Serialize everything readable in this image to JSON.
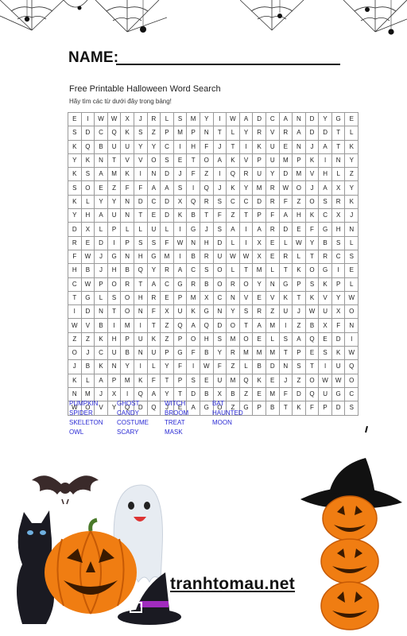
{
  "header": {
    "name_label": "NAME:"
  },
  "puzzle": {
    "title": "Free Printable Halloween Word Search",
    "subtitle": "Hãy tìm các từ dưới đây trong bảng!",
    "grid": [
      [
        "E",
        "I",
        "W",
        "W",
        "X",
        "J",
        "R",
        "L",
        "S",
        "M",
        "Y",
        "I",
        "W",
        "A",
        "D",
        "C",
        "A",
        "N",
        "D",
        "Y",
        "G",
        "E"
      ],
      [
        "S",
        "D",
        "C",
        "Q",
        "K",
        "S",
        "Z",
        "P",
        "M",
        "P",
        "N",
        "T",
        "L",
        "Y",
        "R",
        "V",
        "R",
        "A",
        "D",
        "D",
        "T",
        "L"
      ],
      [
        "K",
        "Q",
        "B",
        "U",
        "U",
        "Y",
        "Y",
        "C",
        "I",
        "H",
        "F",
        "J",
        "T",
        "I",
        "K",
        "U",
        "E",
        "N",
        "J",
        "A",
        "T",
        "K"
      ],
      [
        "Y",
        "K",
        "N",
        "T",
        "V",
        "V",
        "O",
        "S",
        "E",
        "T",
        "O",
        "A",
        "K",
        "V",
        "P",
        "U",
        "M",
        "P",
        "K",
        "I",
        "N",
        "Y"
      ],
      [
        "K",
        "S",
        "A",
        "M",
        "K",
        "I",
        "N",
        "D",
        "J",
        "F",
        "Z",
        "I",
        "Q",
        "R",
        "U",
        "Y",
        "D",
        "M",
        "V",
        "H",
        "L",
        "Z"
      ],
      [
        "S",
        "O",
        "E",
        "Z",
        "F",
        "F",
        "A",
        "A",
        "S",
        "I",
        "Q",
        "J",
        "K",
        "Y",
        "M",
        "R",
        "W",
        "O",
        "J",
        "A",
        "X",
        "Y"
      ],
      [
        "K",
        "L",
        "Y",
        "Y",
        "N",
        "D",
        "C",
        "D",
        "X",
        "Q",
        "R",
        "S",
        "C",
        "C",
        "D",
        "R",
        "F",
        "Z",
        "O",
        "S",
        "R",
        "K"
      ],
      [
        "Y",
        "H",
        "A",
        "U",
        "N",
        "T",
        "E",
        "D",
        "K",
        "B",
        "T",
        "F",
        "Z",
        "T",
        "P",
        "F",
        "A",
        "H",
        "K",
        "C",
        "X",
        "J"
      ],
      [
        "D",
        "X",
        "L",
        "P",
        "L",
        "L",
        "U",
        "L",
        "I",
        "G",
        "J",
        "S",
        "A",
        "I",
        "A",
        "R",
        "D",
        "E",
        "F",
        "G",
        "H",
        "N"
      ],
      [
        "R",
        "E",
        "D",
        "I",
        "P",
        "S",
        "S",
        "F",
        "W",
        "N",
        "H",
        "D",
        "L",
        "I",
        "X",
        "E",
        "L",
        "W",
        "Y",
        "B",
        "S",
        "L"
      ],
      [
        "F",
        "W",
        "J",
        "G",
        "N",
        "H",
        "G",
        "M",
        "I",
        "B",
        "R",
        "U",
        "W",
        "W",
        "X",
        "E",
        "R",
        "L",
        "T",
        "R",
        "C",
        "S"
      ],
      [
        "H",
        "B",
        "J",
        "H",
        "B",
        "Q",
        "Y",
        "R",
        "A",
        "C",
        "S",
        "O",
        "L",
        "T",
        "M",
        "L",
        "T",
        "K",
        "O",
        "G",
        "I",
        "E"
      ],
      [
        "C",
        "W",
        "P",
        "O",
        "R",
        "T",
        "A",
        "C",
        "G",
        "R",
        "B",
        "O",
        "R",
        "O",
        "Y",
        "N",
        "G",
        "P",
        "S",
        "K",
        "P",
        "L"
      ],
      [
        "T",
        "G",
        "L",
        "S",
        "O",
        "H",
        "R",
        "E",
        "P",
        "M",
        "X",
        "C",
        "N",
        "V",
        "E",
        "V",
        "K",
        "T",
        "K",
        "V",
        "Y",
        "W"
      ],
      [
        "I",
        "D",
        "N",
        "T",
        "O",
        "N",
        "F",
        "X",
        "U",
        "K",
        "G",
        "N",
        "Y",
        "S",
        "R",
        "Z",
        "U",
        "J",
        "W",
        "U",
        "X",
        "O"
      ],
      [
        "W",
        "V",
        "B",
        "I",
        "M",
        "I",
        "T",
        "Z",
        "Q",
        "A",
        "Q",
        "D",
        "O",
        "T",
        "A",
        "M",
        "I",
        "Z",
        "B",
        "X",
        "F",
        "N"
      ],
      [
        "Z",
        "Z",
        "K",
        "H",
        "P",
        "U",
        "K",
        "Z",
        "P",
        "O",
        "H",
        "S",
        "M",
        "O",
        "E",
        "L",
        "S",
        "A",
        "Q",
        "E",
        "D",
        "I"
      ],
      [
        "O",
        "J",
        "C",
        "U",
        "B",
        "N",
        "U",
        "P",
        "G",
        "F",
        "B",
        "Y",
        "R",
        "M",
        "M",
        "M",
        "T",
        "P",
        "E",
        "S",
        "K",
        "W"
      ],
      [
        "J",
        "B",
        "K",
        "N",
        "Y",
        "I",
        "L",
        "Y",
        "F",
        "I",
        "W",
        "F",
        "Z",
        "L",
        "B",
        "D",
        "N",
        "S",
        "T",
        "I",
        "U",
        "Q"
      ],
      [
        "K",
        "L",
        "A",
        "P",
        "M",
        "K",
        "F",
        "T",
        "P",
        "S",
        "E",
        "U",
        "M",
        "Q",
        "K",
        "E",
        "J",
        "Z",
        "O",
        "W",
        "W",
        "O"
      ],
      [
        "N",
        "M",
        "J",
        "X",
        "I",
        "Q",
        "A",
        "Y",
        "T",
        "D",
        "B",
        "X",
        "B",
        "Z",
        "E",
        "M",
        "F",
        "D",
        "Q",
        "U",
        "G",
        "C"
      ],
      [
        "W",
        "O",
        "V",
        "Y",
        "Q",
        "D",
        "Q",
        "J",
        "E",
        "A",
        "G",
        "O",
        "Z",
        "G",
        "P",
        "B",
        "T",
        "K",
        "F",
        "P",
        "D",
        "S"
      ]
    ],
    "words": [
      "PUMPKIN",
      "GHOST",
      "WITCH",
      "BAT",
      "SPIDER",
      "CANDY",
      "BROOM",
      "HAUNTED",
      "SKELETON",
      "COSTUME",
      "TREAT",
      "MOON",
      "OWL",
      "SCARY",
      "MASK"
    ]
  },
  "footer": {
    "site": "tranhtomau.net"
  },
  "colors": {
    "word_list": "#2a2ad4",
    "pumpkin": "#f07d12",
    "grid_border": "#9a9a9a"
  }
}
